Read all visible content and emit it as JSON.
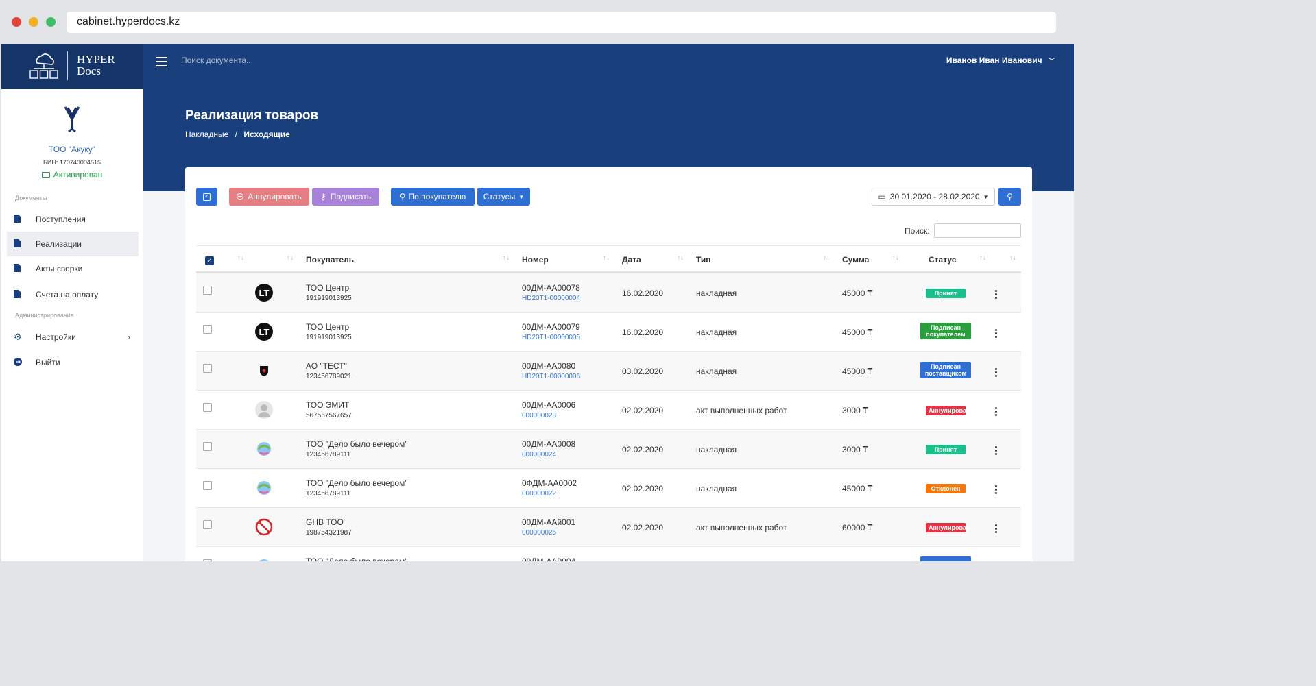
{
  "browser": {
    "url": "cabinet.hyperdocs.kz"
  },
  "app": {
    "logo_line1": "HYPER",
    "logo_line2": "Docs",
    "search_placeholder": "Поиск документа...",
    "user_name": "Иванов Иван Иванович"
  },
  "org": {
    "name": "ТОО \"Акуку\"",
    "bin": "БИН: 170740004515",
    "status": "Активирован"
  },
  "sidebar": {
    "section_docs": "Документы",
    "section_admin": "Администрирование",
    "items": [
      {
        "label": "Поступления",
        "icon": "file-icon"
      },
      {
        "label": "Реализации",
        "icon": "file-icon"
      },
      {
        "label": "Акты сверки",
        "icon": "file-icon"
      },
      {
        "label": "Счета на оплату",
        "icon": "file-icon"
      },
      {
        "label": "Настройки",
        "icon": "gear-icon"
      },
      {
        "label": "Выйти",
        "icon": "exit-icon"
      }
    ]
  },
  "page": {
    "title": "Реализация товаров",
    "crumb1": "Накладные",
    "crumb_sep": "/",
    "crumb2": "Исходящие"
  },
  "toolbar": {
    "annul": "Аннулировать",
    "sign": "Подписать",
    "by_buyer": "По покупателю",
    "statuses": "Статусы",
    "date_range": "30.01.2020 - 28.02.2020",
    "search_label": "Поиск:"
  },
  "colors": {
    "annul": "#e57f84",
    "sign": "#a882d8",
    "primary": "#2f6ed3",
    "accepted": "#1bbf8b",
    "signed_buyer": "#2a9d3d",
    "signed_supplier": "#2f6ed3",
    "annulled": "#dc3545",
    "rejected": "#f0790f"
  },
  "table": {
    "headers": [
      "Покупатель",
      "Номер",
      "Дата",
      "Тип",
      "Сумма",
      "Статус"
    ],
    "rows": [
      {
        "buyer": "ТОО Центр",
        "bin": "191919013925",
        "number": "00ДМ-АА00078",
        "doc": "HD20T1-00000004",
        "date": "16.02.2020",
        "type": "накладная",
        "sum": "45000 ₸",
        "status": "Принят",
        "status_color": "#1bbf8b",
        "avatar": "lt-logo"
      },
      {
        "buyer": "ТОО Центр",
        "bin": "191919013925",
        "number": "00ДМ-АА00079",
        "doc": "HD20T1-00000005",
        "date": "16.02.2020",
        "type": "накладная",
        "sum": "45000 ₸",
        "status": "Подписан покупателем",
        "status_color": "#2a9d3d",
        "avatar": "lt-logo"
      },
      {
        "buyer": "АО \"ТЕСТ\"",
        "bin": "123456789021",
        "number": "00ДМ-АА0080",
        "doc": "HD20T1-00000006",
        "date": "03.02.2020",
        "type": "накладная",
        "sum": "45000 ₸",
        "status": "Подписан поставщиком",
        "status_color": "#2f6ed3",
        "avatar": "shield-logo"
      },
      {
        "buyer": "ТОО ЭМИТ",
        "bin": "567567567657",
        "number": "00ДМ-АА0006",
        "doc": "000000023",
        "date": "02.02.2020",
        "type": "акт выполненных работ",
        "sum": "3000 ₸",
        "status": "Аннулирован",
        "status_color": "#dc3545",
        "avatar": "user-avatar"
      },
      {
        "buyer": "ТОО \"Дело было вечером\"",
        "bin": "123456789111",
        "number": "00ДМ-АА0008",
        "doc": "000000024",
        "date": "02.02.2020",
        "type": "накладная",
        "sum": "3000 ₸",
        "status": "Принят",
        "status_color": "#1bbf8b",
        "avatar": "globe-logo"
      },
      {
        "buyer": "ТОО \"Дело было вечером\"",
        "bin": "123456789111",
        "number": "0ФДМ-АА0002",
        "doc": "000000022",
        "date": "02.02.2020",
        "type": "накладная",
        "sum": "45000 ₸",
        "status": "Отклонен",
        "status_color": "#f0790f",
        "avatar": "globe-logo"
      },
      {
        "buyer": "GHB ТОО",
        "bin": "198754321987",
        "number": "00ДМ-ААй001",
        "doc": "000000025",
        "date": "02.02.2020",
        "type": "акт выполненных работ",
        "sum": "60000 ₸",
        "status": "Аннулирован",
        "status_color": "#dc3545",
        "avatar": "ghost-logo"
      },
      {
        "buyer": "ТОО \"Дело было вечером\"",
        "bin": "",
        "number": "00ДМ-АА0004",
        "doc": "",
        "date": "",
        "type": "",
        "sum": "",
        "status": "",
        "status_color": "#2f6ed3",
        "avatar": "globe-logo"
      }
    ]
  }
}
